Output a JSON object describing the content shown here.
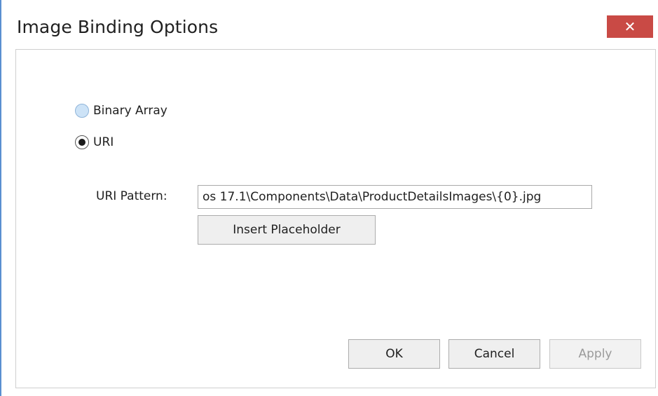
{
  "window": {
    "title": "Image Binding Options",
    "close_glyph": "✕"
  },
  "binding": {
    "options": [
      {
        "label": "Binary Array",
        "selected": false
      },
      {
        "label": "URI",
        "selected": true
      }
    ]
  },
  "uri": {
    "label": "URI Pattern:",
    "value": "os 17.1\\Components\\Data\\ProductDetailsImages\\{0}.jpg",
    "insert_label": "Insert Placeholder"
  },
  "footer": {
    "ok_label": "OK",
    "cancel_label": "Cancel",
    "apply_label": "Apply",
    "apply_enabled": false
  },
  "colors": {
    "close_button": "#c94a45",
    "window_border": "#5a8fd0"
  }
}
